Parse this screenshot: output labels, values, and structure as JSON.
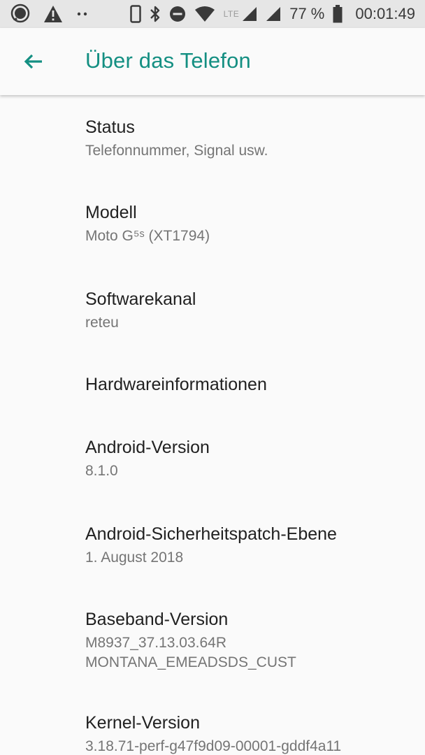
{
  "status_bar": {
    "battery_percent": "77 %",
    "time": "00:01:49",
    "network_label": "LTE",
    "icons": [
      "message-icon",
      "warning-icon",
      "more-dots-icon",
      "phone-icon",
      "bluetooth-icon",
      "do-not-disturb-icon",
      "wifi-icon",
      "signal-icon",
      "battery-icon"
    ]
  },
  "header": {
    "title": "Über das Telefon",
    "accent_color": "#148f82"
  },
  "items": [
    {
      "title": "Status",
      "subtitle": "Telefonnummer, Signal usw."
    },
    {
      "title": "Modell",
      "subtitle": "Moto G⁵ˢ (XT1794)"
    },
    {
      "title": "Softwarekanal",
      "subtitle": "reteu"
    },
    {
      "title": "Hardwareinformationen"
    },
    {
      "title": "Android-Version",
      "subtitle": "8.1.0"
    },
    {
      "title": "Android-Sicherheitspatch-Ebene",
      "subtitle": "1. August 2018"
    },
    {
      "title": "Baseband-Version",
      "subtitle": "M8937_37.13.03.64R",
      "subtitle2": "MONTANA_EMEADSDS_CUST"
    },
    {
      "title": "Kernel-Version",
      "subtitle": "3.18.71-perf-g47f9d09-00001-gddf4a11"
    }
  ]
}
